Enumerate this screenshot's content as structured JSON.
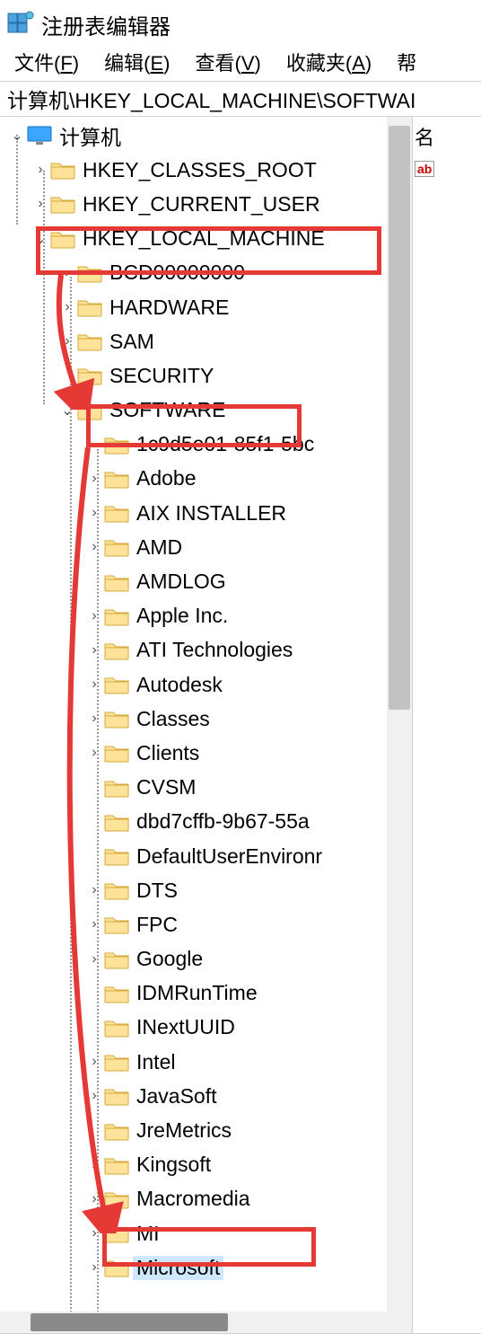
{
  "window": {
    "title": "注册表编辑器"
  },
  "menu": {
    "file": {
      "label": "文件",
      "accel": "F"
    },
    "edit": {
      "label": "编辑",
      "accel": "E"
    },
    "view": {
      "label": "查看",
      "accel": "V"
    },
    "fav": {
      "label": "收藏夹",
      "accel": "A"
    },
    "help_partial": "帮"
  },
  "addressbar": {
    "path": "计算机\\HKEY_LOCAL_MACHINE\\SOFTWAI"
  },
  "right": {
    "column_partial": "名",
    "ab_icon_text": "ab"
  },
  "tree": {
    "root": {
      "label": "计算机",
      "expanded": true
    },
    "lvl1": [
      {
        "label": "HKEY_CLASSES_ROOT",
        "expander": ">"
      },
      {
        "label": "HKEY_CURRENT_USER",
        "expander": ">"
      },
      {
        "label": "HKEY_LOCAL_MACHINE",
        "expander": "v",
        "highlight": true
      }
    ],
    "hklm": [
      {
        "label": "BCD00000000",
        "expander": ">"
      },
      {
        "label": "HARDWARE",
        "expander": ">"
      },
      {
        "label": "SAM",
        "expander": ">"
      },
      {
        "label": "SECURITY",
        "expander": ""
      },
      {
        "label": "SOFTWARE",
        "expander": "v",
        "highlight": true
      }
    ],
    "software": [
      {
        "label": "1c9d5e01-85f1-5bc",
        "expander": ""
      },
      {
        "label": "Adobe",
        "expander": ">"
      },
      {
        "label": "AIX INSTALLER",
        "expander": ">"
      },
      {
        "label": "AMD",
        "expander": ">"
      },
      {
        "label": "AMDLOG",
        "expander": ""
      },
      {
        "label": "Apple Inc.",
        "expander": ">"
      },
      {
        "label": "ATI Technologies",
        "expander": ">"
      },
      {
        "label": "Autodesk",
        "expander": ">"
      },
      {
        "label": "Classes",
        "expander": ">"
      },
      {
        "label": "Clients",
        "expander": ">"
      },
      {
        "label": "CVSM",
        "expander": ""
      },
      {
        "label": "dbd7cffb-9b67-55a",
        "expander": ""
      },
      {
        "label": "DefaultUserEnvironr",
        "expander": ""
      },
      {
        "label": "DTS",
        "expander": ">"
      },
      {
        "label": "FPC",
        "expander": ">"
      },
      {
        "label": "Google",
        "expander": ">"
      },
      {
        "label": "IDMRunTime",
        "expander": ""
      },
      {
        "label": "INextUUID",
        "expander": ""
      },
      {
        "label": "Intel",
        "expander": ">"
      },
      {
        "label": "JavaSoft",
        "expander": ">"
      },
      {
        "label": "JreMetrics",
        "expander": ""
      },
      {
        "label": "Kingsoft",
        "expander": ">"
      },
      {
        "label": "Macromedia",
        "expander": ">"
      },
      {
        "label": "MI",
        "expander": ">"
      },
      {
        "label": "Microsoft",
        "expander": ">",
        "highlight": true,
        "selected": true
      }
    ]
  }
}
